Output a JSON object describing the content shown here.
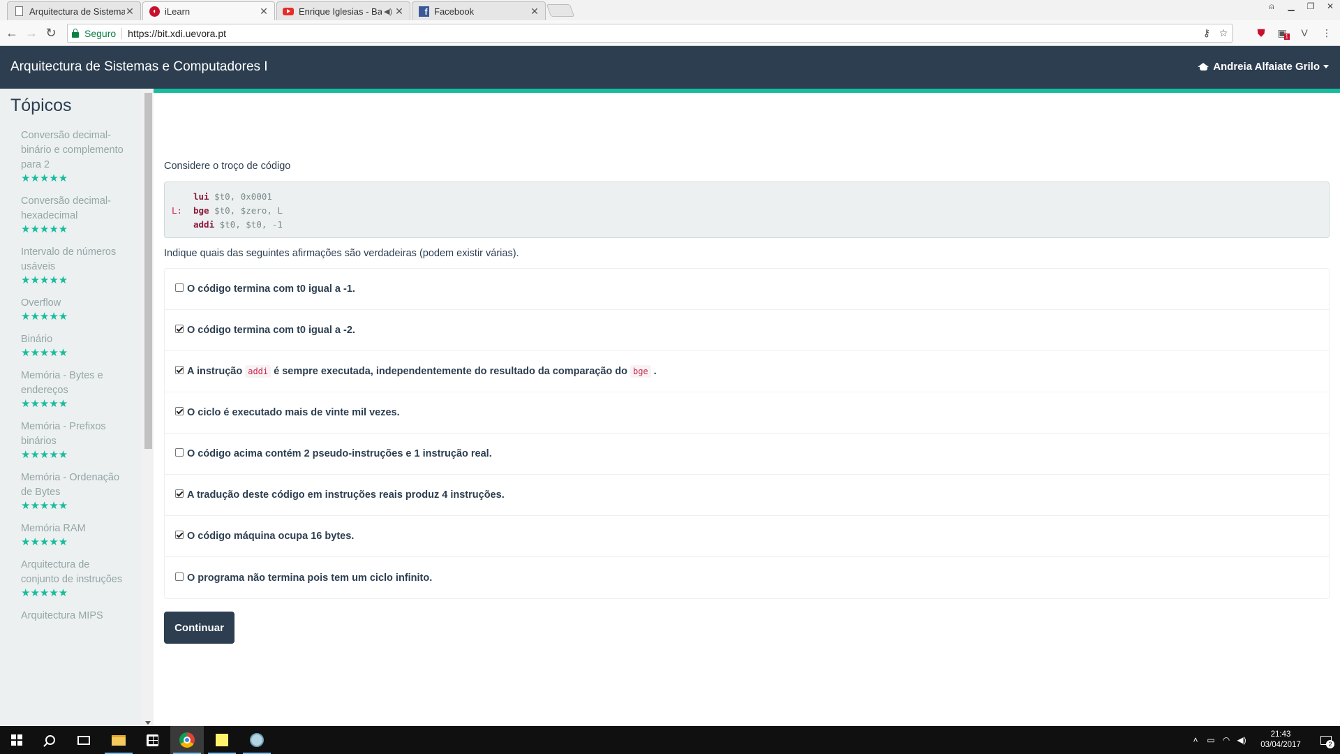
{
  "browser": {
    "tabs": [
      {
        "title": "Arquitectura de Sistemas",
        "favicon": "document-icon",
        "active": false
      },
      {
        "title": "iLearn",
        "favicon": "ilearn-icon",
        "active": true
      },
      {
        "title": "Enrique Iglesias - Bail",
        "favicon": "youtube-icon",
        "active": false
      },
      {
        "title": "Facebook",
        "favicon": "facebook-icon",
        "active": false
      }
    ],
    "secure_label": "Seguro",
    "url": "https://bit.xdi.uevora.pt",
    "extension_badge": "1"
  },
  "app": {
    "title": "Arquitectura de Sistemas e Computadores I",
    "user_name": "Andreia Alfaiate Grilo",
    "accent_color": "#18bc9c",
    "navbar_color": "#2c3e50"
  },
  "sidebar": {
    "title": "Tópicos",
    "topics": [
      {
        "label": "Conversão decimal-binário e complemento para 2",
        "stars": "★★★★★"
      },
      {
        "label": "Conversão decimal-hexadecimal",
        "stars": "★★★★★"
      },
      {
        "label": "Intervalo de números usáveis",
        "stars": "★★★★★"
      },
      {
        "label": "Overflow",
        "stars": "★★★★★"
      },
      {
        "label": "Binário",
        "stars": "★★★★★"
      },
      {
        "label": "Memória - Bytes e endereços",
        "stars": "★★★★★"
      },
      {
        "label": "Memória - Prefixos binários",
        "stars": "★★★★★"
      },
      {
        "label": "Memória - Ordenação de Bytes",
        "stars": "★★★★★"
      },
      {
        "label": "Memória RAM",
        "stars": "★★★★★"
      },
      {
        "label": "Arquitectura de conjunto de instruções",
        "stars": "★★★★★"
      },
      {
        "label": "Arquitectura MIPS",
        "stars": ""
      }
    ]
  },
  "question": {
    "prompt": "Considere o troço de código",
    "code": [
      {
        "label": "",
        "op": "lui",
        "args": "$t0, 0x0001"
      },
      {
        "label": "L:",
        "op": "bge",
        "args": "$t0, $zero, L"
      },
      {
        "label": "",
        "op": "addi",
        "args": "$t0, $t0, -1"
      }
    ],
    "instruction": "Indique quais das seguintes afirmações são verdadeiras (podem existir várias).",
    "options": [
      {
        "text": "O código termina com t0 igual a -1.",
        "checked": false
      },
      {
        "text": "O código termina com t0 igual a -2.",
        "checked": true
      },
      {
        "pre": "A instrução",
        "code1": "addi",
        "mid": "é sempre executada, independentemente do resultado da comparação do",
        "code2": "bge",
        "post": ".",
        "checked": true
      },
      {
        "text": "O ciclo é executado mais de vinte mil vezes.",
        "checked": true
      },
      {
        "text": "O código acima contém 2 pseudo-instruções e 1 instrução real.",
        "checked": false
      },
      {
        "text": "A tradução deste código em instruções reais produz 4 instruções.",
        "checked": true
      },
      {
        "text": "O código máquina ocupa 16 bytes.",
        "checked": true
      },
      {
        "text": "O programa não termina pois tem um ciclo infinito.",
        "checked": false
      }
    ],
    "continue_label": "Continuar"
  },
  "taskbar": {
    "time": "21:43",
    "date": "03/04/2017",
    "notification_count": "2"
  }
}
